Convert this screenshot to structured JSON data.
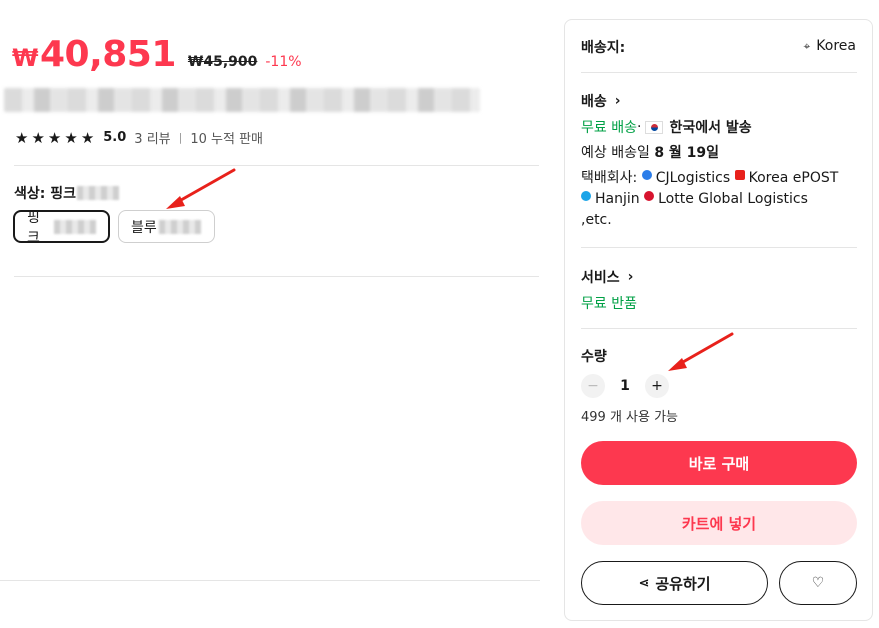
{
  "product": {
    "currency": "₩",
    "price": "40,851",
    "original_price": "₩45,900",
    "discount": "-11%",
    "rating_score": "5.0",
    "reviews": "3 리뷰",
    "sold": "10 누적 판매",
    "color_label": "색상: 핑크",
    "options": [
      {
        "label": "핑크",
        "selected": true
      },
      {
        "label": "블루",
        "selected": false
      }
    ]
  },
  "shipping": {
    "label": "배송지:",
    "destination": "Korea",
    "section_title": "배송",
    "free_shipping": "무료 배송",
    "dot": " · ",
    "origin": "한국에서 발송",
    "eta_prefix": "예상 배송일",
    "eta_date": "8 월 19일",
    "carriers_prefix": "택배회사:",
    "carrier_1": "CJLogistics",
    "carrier_2": "Korea ePOST",
    "carrier_3": "Hanjin",
    "carrier_4": "Lotte Global Logistics ,etc."
  },
  "service": {
    "title": "서비스",
    "free_return": "무료 반품"
  },
  "quantity": {
    "label": "수량",
    "value": "1",
    "minus": "−",
    "plus": "+",
    "available": "499 개 사용 가능"
  },
  "actions": {
    "buy_now": "바로 구매",
    "add_to_cart": "카트에 넣기",
    "share": "공유하기"
  },
  "colors": {
    "accent": "#fd384f",
    "cart_bg": "#ffe7e9",
    "green": "#00a045",
    "annotation_arrow": "#e8211b"
  },
  "icons": {
    "star": "star-icon",
    "location": "location-pin-icon",
    "chevron": "chevron-right-icon",
    "share": "share-icon",
    "heart": "heart-icon"
  }
}
